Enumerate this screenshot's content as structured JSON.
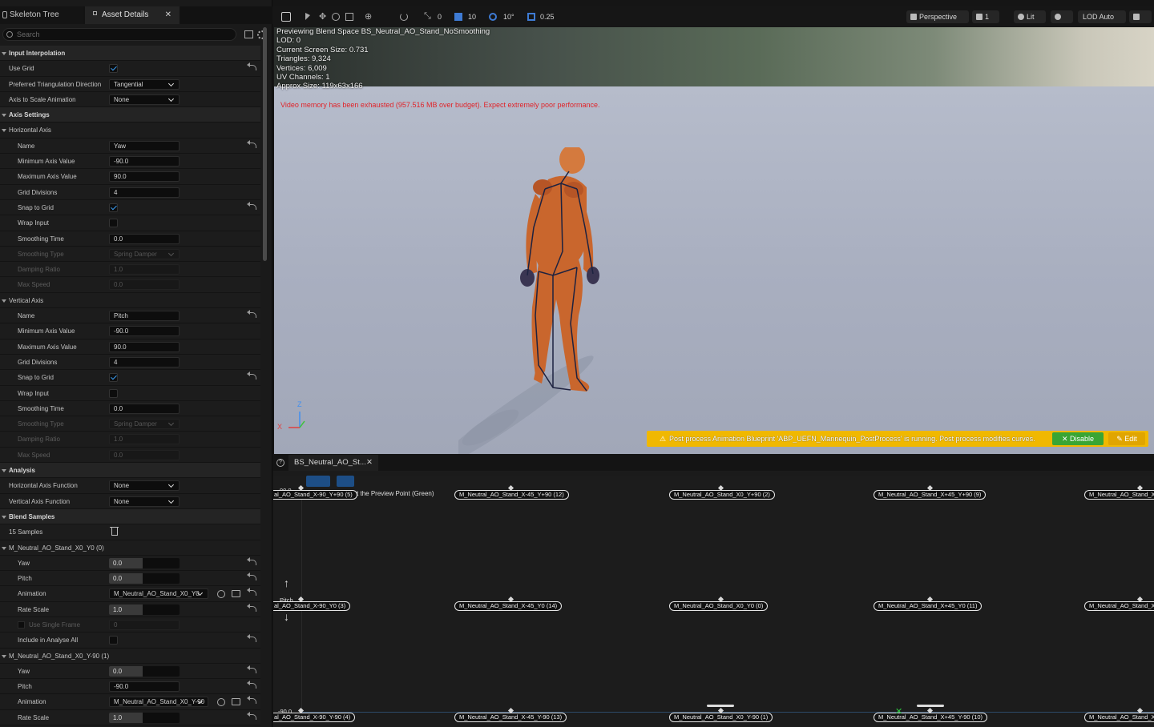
{
  "tabs": {
    "skeleton_tree": "Skeleton Tree",
    "asset_details": "Asset Details",
    "close": "✕"
  },
  "search": {
    "placeholder": "Search"
  },
  "details": {
    "rows": [
      {
        "kind": "cat",
        "label": "Input Interpolation"
      },
      {
        "kind": "prop",
        "label": "Use Grid",
        "checkbox": true,
        "reset": true
      },
      {
        "kind": "prop",
        "label": "Preferred Triangulation Direction",
        "dropdown": "Tangential"
      },
      {
        "kind": "prop",
        "label": "Axis to Scale Animation",
        "dropdown": "None"
      },
      {
        "kind": "cat",
        "label": "Axis Settings"
      },
      {
        "kind": "sub",
        "label": "Horizontal Axis"
      },
      {
        "kind": "prop2",
        "label": "Name",
        "value": "Yaw",
        "reset": true
      },
      {
        "kind": "prop2",
        "label": "Minimum Axis Value",
        "value": "-90.0"
      },
      {
        "kind": "prop2",
        "label": "Maximum Axis Value",
        "value": "90.0"
      },
      {
        "kind": "prop2",
        "label": "Grid Divisions",
        "value": "4"
      },
      {
        "kind": "prop2",
        "label": "Snap to Grid",
        "checkbox": true,
        "reset": true
      },
      {
        "kind": "prop2",
        "label": "Wrap Input",
        "checkbox": false
      },
      {
        "kind": "prop2",
        "label": "Smoothing Time",
        "value": "0.0"
      },
      {
        "kind": "prop2",
        "label": "Smoothing Type",
        "dropdown": "Spring Damper",
        "disabled": true
      },
      {
        "kind": "prop2",
        "label": "Damping Ratio",
        "value": "1.0",
        "disabled": true
      },
      {
        "kind": "prop2",
        "label": "Max Speed",
        "value": "0.0",
        "disabled": true
      },
      {
        "kind": "sub",
        "label": "Vertical Axis"
      },
      {
        "kind": "prop2",
        "label": "Name",
        "value": "Pitch",
        "reset": true
      },
      {
        "kind": "prop2",
        "label": "Minimum Axis Value",
        "value": "-90.0"
      },
      {
        "kind": "prop2",
        "label": "Maximum Axis Value",
        "value": "90.0"
      },
      {
        "kind": "prop2",
        "label": "Grid Divisions",
        "value": "4"
      },
      {
        "kind": "prop2",
        "label": "Snap to Grid",
        "checkbox": true,
        "reset": true
      },
      {
        "kind": "prop2",
        "label": "Wrap Input",
        "checkbox": false
      },
      {
        "kind": "prop2",
        "label": "Smoothing Time",
        "value": "0.0"
      },
      {
        "kind": "prop2",
        "label": "Smoothing Type",
        "dropdown": "Spring Damper",
        "disabled": true
      },
      {
        "kind": "prop2",
        "label": "Damping Ratio",
        "value": "1.0",
        "disabled": true
      },
      {
        "kind": "prop2",
        "label": "Max Speed",
        "value": "0.0",
        "disabled": true
      },
      {
        "kind": "cat",
        "label": "Analysis"
      },
      {
        "kind": "prop",
        "label": "Horizontal Axis Function",
        "dropdown": "None"
      },
      {
        "kind": "prop",
        "label": "Vertical Axis Function",
        "dropdown": "None"
      },
      {
        "kind": "cat",
        "label": "Blend Samples"
      },
      {
        "kind": "prop",
        "label": "15 Samples",
        "trash": true
      },
      {
        "kind": "sub",
        "label": "M_Neutral_AO_Stand_X0_Y0 (0)"
      },
      {
        "kind": "prop2",
        "label": "Yaw",
        "slider": "0.0",
        "reset": true
      },
      {
        "kind": "prop2",
        "label": "Pitch",
        "slider": "0.0",
        "reset": true
      },
      {
        "kind": "prop2",
        "label": "Animation",
        "anim": "M_Neutral_AO_Stand_X0_Y0",
        "reset": true
      },
      {
        "kind": "prop2",
        "label": "Rate Scale",
        "slider": "1.0",
        "reset": true
      },
      {
        "kind": "prop3",
        "label": "Use Single Frame",
        "value": "0",
        "disabled": true
      },
      {
        "kind": "prop2",
        "label": "Include in Analyse All",
        "checkbox": false,
        "reset": true
      },
      {
        "kind": "sub",
        "label": "M_Neutral_AO_Stand_X0_Y-90 (1)"
      },
      {
        "kind": "prop2",
        "label": "Yaw",
        "slider": "0.0",
        "reset": true
      },
      {
        "kind": "prop2",
        "label": "Pitch",
        "value": "-90.0",
        "reset": true
      },
      {
        "kind": "prop2",
        "label": "Animation",
        "anim": "M_Neutral_AO_Stand_X0_Y-90",
        "reset": true
      },
      {
        "kind": "prop2",
        "label": "Rate Scale",
        "slider": "1.0",
        "reset": true
      }
    ]
  },
  "toolbar": {
    "snap_rot": "0",
    "grid_snap": "10",
    "rot_snap": "10°",
    "scale_snap": "0.25",
    "perspective": "Perspective",
    "cam_speed": "1",
    "lit": "Lit",
    "lod": "LOD Auto"
  },
  "viewport": {
    "stats": [
      "Previewing Blend Space BS_Neutral_AO_Stand_NoSmoothing",
      "LOD: 0",
      "Current Screen Size: 0.731",
      "Triangles: 9,324",
      "Vertices: 6,009",
      "UV Channels: 1",
      "Approx Size: 119x63x166"
    ],
    "video_warning": "Video memory has been exhausted (957.516 MB over budget). Expect extremely poor performance.",
    "axis_z": "Z",
    "axis_x": "X",
    "post_warning": "Post process Animation Blueprint 'ABP_UEFN_Mannequin_PostProcess' is running. Post process modifies curves.",
    "disable": "✕ Disable",
    "edit": "✎ Edit"
  },
  "blendspace": {
    "tab": "BS_Neutral_AO_St...",
    "hint": "Hold Control to set the Preview Point (Green)",
    "ymax": "90.0",
    "ymin": "-90.0",
    "ylabel": "Pitch",
    "samples_top": [
      "al_AO_Stand_X-90_Y+90 (5)",
      "M_Neutral_AO_Stand_X-45_Y+90 (12)",
      "M_Neutral_AO_Stand_X0_Y+90 (2)",
      "M_Neutral_AO_Stand_X+45_Y+90 (9)",
      "M_Neutral_AO_Stand_X+"
    ],
    "samples_mid": [
      "al_AO_Stand_X-90_Y0 (3)",
      "M_Neutral_AO_Stand_X-45_Y0 (14)",
      "M_Neutral_AO_Stand_X0_Y0 (0)",
      "M_Neutral_AO_Stand_X+45_Y0 (11)",
      "M_Neutral_AO_Stand_X"
    ],
    "samples_bot": [
      "al_AO_Stand_X-90_Y-90 (4)",
      "M_Neutral_AO_Stand_X-45_Y-90 (13)",
      "M_Neutral_AO_Stand_X0_Y-90 (1)",
      "M_Neutral_AO_Stand_X+45_Y-90 (10)",
      "M_Neutral_AO_Stand_X+"
    ]
  }
}
